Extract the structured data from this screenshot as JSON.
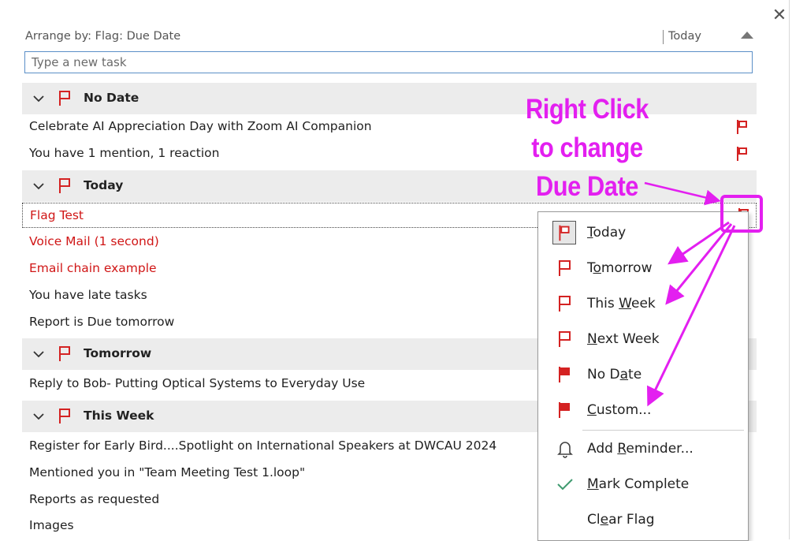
{
  "header": {
    "arrange_by": "Arrange by: Flag: Due Date",
    "sort_label": "Today"
  },
  "new_task": {
    "placeholder": "Type a new task"
  },
  "groups": [
    {
      "title": "No Date",
      "items": [
        {
          "text": "Celebrate AI Appreciation Day with Zoom AI Companion"
        },
        {
          "text": "You have 1 mention, 1 reaction"
        }
      ]
    },
    {
      "title": "Today",
      "items": [
        {
          "text": "Flag Test"
        },
        {
          "text": "Voice Mail (1 second)"
        },
        {
          "text": "Email chain example"
        },
        {
          "text": "You have late tasks"
        },
        {
          "text": "Report is Due tomorrow"
        }
      ]
    },
    {
      "title": "Tomorrow",
      "items": [
        {
          "text": "Reply to Bob- Putting Optical Systems to Everyday Use"
        }
      ]
    },
    {
      "title": "This Week",
      "items": [
        {
          "text": "Register for Early Bird....Spotlight on International Speakers at DWCAU 2024"
        },
        {
          "text": "Mentioned you in \"Team Meeting Test 1.loop\""
        },
        {
          "text": "Reports as requested"
        },
        {
          "text": "Images"
        }
      ]
    }
  ],
  "context_menu": {
    "items": [
      {
        "pre": "",
        "u": "T",
        "post": "oday",
        "icon": "flag-icon"
      },
      {
        "pre": "T",
        "u": "o",
        "post": "morrow",
        "icon": "flag-outline-icon"
      },
      {
        "pre": "This ",
        "u": "W",
        "post": "eek",
        "icon": "flag-outline-icon"
      },
      {
        "pre": "",
        "u": "N",
        "post": "ext Week",
        "icon": "flag-outline-icon"
      },
      {
        "pre": "No D",
        "u": "a",
        "post": "te",
        "icon": "flag-icon"
      },
      {
        "pre": "",
        "u": "C",
        "post": "ustom...",
        "icon": "flag-icon"
      },
      {
        "pre": "Add ",
        "u": "R",
        "post": "eminder...",
        "icon": "bell-icon"
      },
      {
        "pre": "",
        "u": "M",
        "post": "ark Complete",
        "icon": "checkmark-icon"
      },
      {
        "pre": "Cl",
        "u": "e",
        "post": "ar Flag",
        "icon": ""
      }
    ]
  },
  "annotation": {
    "line1": "Right Click",
    "line2": "to change",
    "line3": "Due Date"
  },
  "colors": {
    "flag_red": "#d42222",
    "overdue_text": "#d01616",
    "annotation_magenta": "#e31ff0",
    "group_header_bg": "#ececec"
  }
}
